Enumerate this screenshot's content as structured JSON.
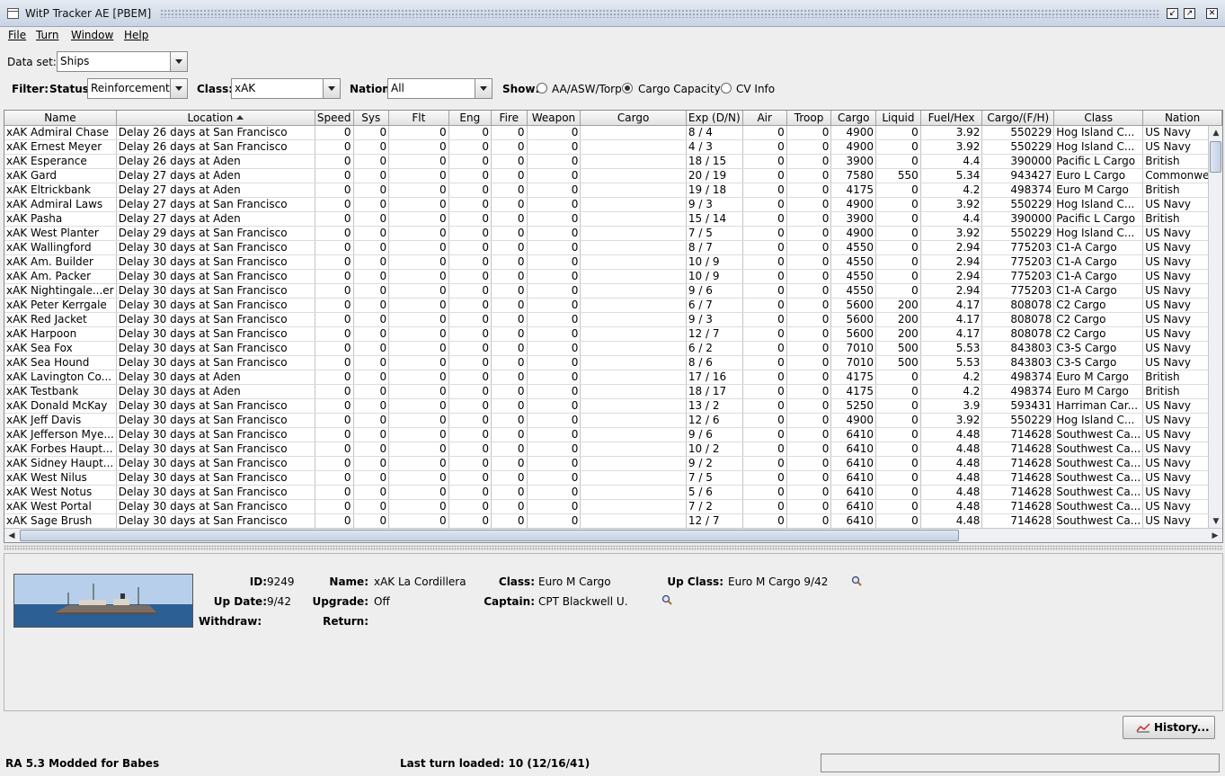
{
  "window": {
    "title": "WitP Tracker AE [PBEM]"
  },
  "menu": [
    "File",
    "Turn",
    "Window",
    "Help"
  ],
  "dataset": {
    "label": "Data set:",
    "value": "Ships"
  },
  "filter": {
    "label": "Filter:",
    "status_label": "Status:",
    "status_value": "Reinforcement",
    "class_label": "Class:",
    "class_value": "xAK",
    "nation_label": "Nation:",
    "nation_value": "All",
    "show_label": "Show:",
    "show_options": [
      "AA/ASW/Torp",
      "Cargo Capacity",
      "CV Info"
    ],
    "show_selected": "Cargo Capacity"
  },
  "table": {
    "columns": [
      "Name",
      "Location",
      "Speed",
      "Sys",
      "Flt",
      "Eng",
      "Fire",
      "Weapon",
      "Cargo",
      "Exp (D/N)",
      "Air",
      "Troop",
      "Cargo",
      "Liquid",
      "Fuel/Hex",
      "Cargo/(F/H)",
      "Class",
      "Nation"
    ],
    "sorted_column": "Location",
    "rows": [
      [
        "xAK Admiral Chase",
        "Delay 26 days at San Francisco",
        "0",
        "0",
        "0",
        "0",
        "0",
        "0",
        "",
        "8 / 4",
        "0",
        "0",
        "4900",
        "0",
        "3.92",
        "550229",
        "Hog Island C...",
        "US Navy"
      ],
      [
        "xAK Ernest Meyer",
        "Delay 26 days at San Francisco",
        "0",
        "0",
        "0",
        "0",
        "0",
        "0",
        "",
        "4 / 3",
        "0",
        "0",
        "4900",
        "0",
        "3.92",
        "550229",
        "Hog Island C...",
        "US Navy"
      ],
      [
        "xAK Esperance",
        "Delay 26 days at Aden",
        "0",
        "0",
        "0",
        "0",
        "0",
        "0",
        "",
        "18 / 15",
        "0",
        "0",
        "3900",
        "0",
        "4.4",
        "390000",
        "Pacific L Cargo",
        "British"
      ],
      [
        "xAK Gard",
        "Delay 27 days at Aden",
        "0",
        "0",
        "0",
        "0",
        "0",
        "0",
        "",
        "20 / 19",
        "0",
        "0",
        "7580",
        "550",
        "5.34",
        "943427",
        "Euro L Cargo",
        "Commonwe..."
      ],
      [
        "xAK Eltrickbank",
        "Delay 27 days at Aden",
        "0",
        "0",
        "0",
        "0",
        "0",
        "0",
        "",
        "19 / 18",
        "0",
        "0",
        "4175",
        "0",
        "4.2",
        "498374",
        "Euro M Cargo",
        "British"
      ],
      [
        "xAK Admiral Laws",
        "Delay 27 days at San Francisco",
        "0",
        "0",
        "0",
        "0",
        "0",
        "0",
        "",
        "9 / 3",
        "0",
        "0",
        "4900",
        "0",
        "3.92",
        "550229",
        "Hog Island C...",
        "US Navy"
      ],
      [
        "xAK Pasha",
        "Delay 27 days at Aden",
        "0",
        "0",
        "0",
        "0",
        "0",
        "0",
        "",
        "15 / 14",
        "0",
        "0",
        "3900",
        "0",
        "4.4",
        "390000",
        "Pacific L Cargo",
        "British"
      ],
      [
        "xAK West Planter",
        "Delay 29 days at San Francisco",
        "0",
        "0",
        "0",
        "0",
        "0",
        "0",
        "",
        "7 / 5",
        "0",
        "0",
        "4900",
        "0",
        "3.92",
        "550229",
        "Hog Island C...",
        "US Navy"
      ],
      [
        "xAK Wallingford",
        "Delay 30 days at San Francisco",
        "0",
        "0",
        "0",
        "0",
        "0",
        "0",
        "",
        "8 / 7",
        "0",
        "0",
        "4550",
        "0",
        "2.94",
        "775203",
        "C1-A Cargo",
        "US Navy"
      ],
      [
        "xAK Am. Builder",
        "Delay 30 days at San Francisco",
        "0",
        "0",
        "0",
        "0",
        "0",
        "0",
        "",
        "10 / 9",
        "0",
        "0",
        "4550",
        "0",
        "2.94",
        "775203",
        "C1-A Cargo",
        "US Navy"
      ],
      [
        "xAK Am. Packer",
        "Delay 30 days at San Francisco",
        "0",
        "0",
        "0",
        "0",
        "0",
        "0",
        "",
        "10 / 9",
        "0",
        "0",
        "4550",
        "0",
        "2.94",
        "775203",
        "C1-A Cargo",
        "US Navy"
      ],
      [
        "xAK Nightingale...er",
        "Delay 30 days at San Francisco",
        "0",
        "0",
        "0",
        "0",
        "0",
        "0",
        "",
        "9 / 6",
        "0",
        "0",
        "4550",
        "0",
        "2.94",
        "775203",
        "C1-A Cargo",
        "US Navy"
      ],
      [
        "xAK Peter Kerrgale",
        "Delay 30 days at San Francisco",
        "0",
        "0",
        "0",
        "0",
        "0",
        "0",
        "",
        "6 / 7",
        "0",
        "0",
        "5600",
        "200",
        "4.17",
        "808078",
        "C2 Cargo",
        "US Navy"
      ],
      [
        "xAK Red Jacket",
        "Delay 30 days at San Francisco",
        "0",
        "0",
        "0",
        "0",
        "0",
        "0",
        "",
        "9 / 3",
        "0",
        "0",
        "5600",
        "200",
        "4.17",
        "808078",
        "C2 Cargo",
        "US Navy"
      ],
      [
        "xAK Harpoon",
        "Delay 30 days at San Francisco",
        "0",
        "0",
        "0",
        "0",
        "0",
        "0",
        "",
        "12 / 7",
        "0",
        "0",
        "5600",
        "200",
        "4.17",
        "808078",
        "C2 Cargo",
        "US Navy"
      ],
      [
        "xAK Sea Fox",
        "Delay 30 days at San Francisco",
        "0",
        "0",
        "0",
        "0",
        "0",
        "0",
        "",
        "6 / 2",
        "0",
        "0",
        "7010",
        "500",
        "5.53",
        "843803",
        "C3-S Cargo",
        "US Navy"
      ],
      [
        "xAK Sea Hound",
        "Delay 30 days at San Francisco",
        "0",
        "0",
        "0",
        "0",
        "0",
        "0",
        "",
        "8 / 6",
        "0",
        "0",
        "7010",
        "500",
        "5.53",
        "843803",
        "C3-S Cargo",
        "US Navy"
      ],
      [
        "xAK Lavington Co...",
        "Delay 30 days at Aden",
        "0",
        "0",
        "0",
        "0",
        "0",
        "0",
        "",
        "17 / 16",
        "0",
        "0",
        "4175",
        "0",
        "4.2",
        "498374",
        "Euro M Cargo",
        "British"
      ],
      [
        "xAK Testbank",
        "Delay 30 days at Aden",
        "0",
        "0",
        "0",
        "0",
        "0",
        "0",
        "",
        "18 / 17",
        "0",
        "0",
        "4175",
        "0",
        "4.2",
        "498374",
        "Euro M Cargo",
        "British"
      ],
      [
        "xAK Donald McKay",
        "Delay 30 days at San Francisco",
        "0",
        "0",
        "0",
        "0",
        "0",
        "0",
        "",
        "13 / 2",
        "0",
        "0",
        "5250",
        "0",
        "3.9",
        "593431",
        "Harriman Car...",
        "US Navy"
      ],
      [
        "xAK Jeff Davis",
        "Delay 30 days at San Francisco",
        "0",
        "0",
        "0",
        "0",
        "0",
        "0",
        "",
        "12 / 6",
        "0",
        "0",
        "4900",
        "0",
        "3.92",
        "550229",
        "Hog Island C...",
        "US Navy"
      ],
      [
        "xAK Jefferson Mye...",
        "Delay 30 days at San Francisco",
        "0",
        "0",
        "0",
        "0",
        "0",
        "0",
        "",
        "9 / 6",
        "0",
        "0",
        "6410",
        "0",
        "4.48",
        "714628",
        "Southwest Ca...",
        "US Navy"
      ],
      [
        "xAK Forbes Haupt...",
        "Delay 30 days at San Francisco",
        "0",
        "0",
        "0",
        "0",
        "0",
        "0",
        "",
        "10 / 2",
        "0",
        "0",
        "6410",
        "0",
        "4.48",
        "714628",
        "Southwest Ca...",
        "US Navy"
      ],
      [
        "xAK Sidney Haupt...",
        "Delay 30 days at San Francisco",
        "0",
        "0",
        "0",
        "0",
        "0",
        "0",
        "",
        "9 / 2",
        "0",
        "0",
        "6410",
        "0",
        "4.48",
        "714628",
        "Southwest Ca...",
        "US Navy"
      ],
      [
        "xAK West Nilus",
        "Delay 30 days at San Francisco",
        "0",
        "0",
        "0",
        "0",
        "0",
        "0",
        "",
        "7 / 5",
        "0",
        "0",
        "6410",
        "0",
        "4.48",
        "714628",
        "Southwest Ca...",
        "US Navy"
      ],
      [
        "xAK West Notus",
        "Delay 30 days at San Francisco",
        "0",
        "0",
        "0",
        "0",
        "0",
        "0",
        "",
        "5 / 6",
        "0",
        "0",
        "6410",
        "0",
        "4.48",
        "714628",
        "Southwest Ca...",
        "US Navy"
      ],
      [
        "xAK West Portal",
        "Delay 30 days at San Francisco",
        "0",
        "0",
        "0",
        "0",
        "0",
        "0",
        "",
        "7 / 2",
        "0",
        "0",
        "6410",
        "0",
        "4.48",
        "714628",
        "Southwest Ca...",
        "US Navy"
      ],
      [
        "xAK Sage Brush",
        "Delay 30 days at San Francisco",
        "0",
        "0",
        "0",
        "0",
        "0",
        "0",
        "",
        "12 / 7",
        "0",
        "0",
        "6410",
        "0",
        "4.48",
        "714628",
        "Southwest Ca...",
        "US Navy"
      ]
    ]
  },
  "detail": {
    "id_label": "ID:",
    "id": "9249",
    "name_label": "Name:",
    "name": "xAK La Cordillera",
    "class_label": "Class:",
    "class": "Euro M Cargo",
    "upclass_label": "Up Class:",
    "upclass": "Euro M Cargo 9/42",
    "update_label": "Up Date:",
    "update": "9/42",
    "upgrade_label": "Upgrade:",
    "upgrade": "Off",
    "captain_label": "Captain:",
    "captain": "CPT Blackwell U.",
    "withdraw_label": "Withdraw:",
    "return_label": "Return:"
  },
  "history_button": "History...",
  "status": {
    "left": "RA 5.3 Modded for Babes",
    "middle": "Last turn loaded: 10 (12/16/41)"
  }
}
